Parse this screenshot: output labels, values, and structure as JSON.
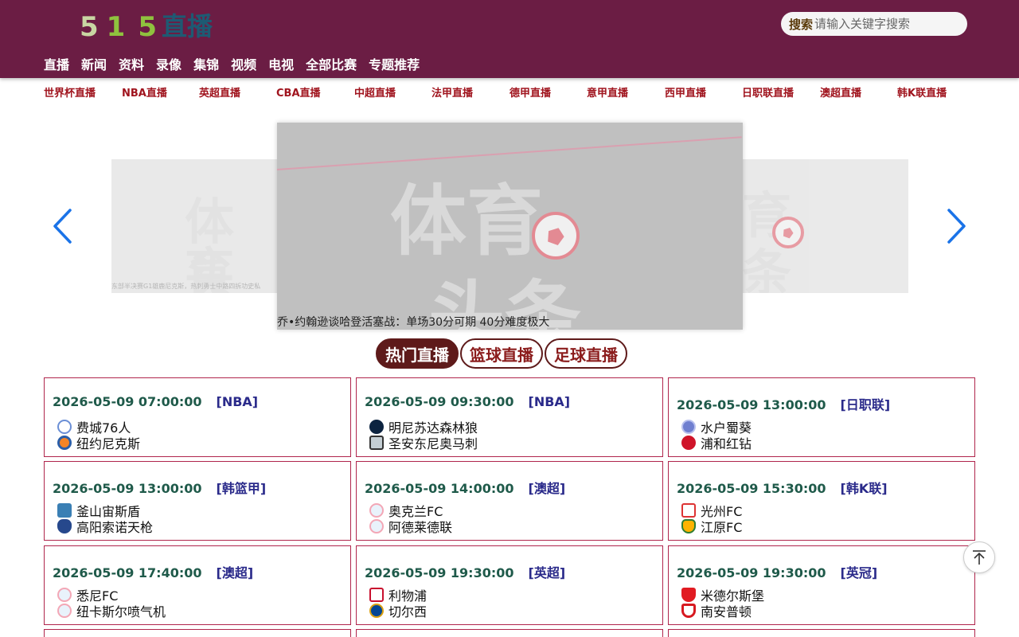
{
  "logo": {
    "digit1": "5",
    "digit2": "1",
    "digit3": "5",
    "text": "直播"
  },
  "search": {
    "label": "搜索",
    "placeholder": "请输入关键字搜索"
  },
  "main_nav": [
    "直播",
    "新闻",
    "资料",
    "录像",
    "集锦",
    "视频",
    "电视",
    "全部比赛",
    "专题推荐"
  ],
  "sub_nav": [
    "世界杯直播",
    "NBA直播",
    "英超直播",
    "CBA直播",
    "中超直播",
    "法甲直播",
    "德甲直播",
    "意甲直播",
    "西甲直播",
    "日职联直播",
    "澳超直播",
    "韩K联直播"
  ],
  "carousel": {
    "center_caption": "乔•约翰逊谈哈登活塞战：单场30分可期 40分难度极大",
    "left_caption": "东部半决赛G1雄鹿尼克斯，热刺勇士中路四拆功史私",
    "watermark_line1": "体育",
    "watermark_line2": "头条"
  },
  "tabs": [
    {
      "label": "热门直播",
      "active": true
    },
    {
      "label": "篮球直播",
      "active": false
    },
    {
      "label": "足球直播",
      "active": false
    }
  ],
  "matches": [
    {
      "time": "2026-05-09 07:00:00",
      "league": "[NBA]",
      "home": "费城76人",
      "away": "纽约尼克斯",
      "home_icon": "nba76",
      "away_icon": "knicks"
    },
    {
      "time": "2026-05-09 09:30:00",
      "league": "[NBA]",
      "home": "明尼苏达森林狼",
      "away": "圣安东尼奥马刺",
      "home_icon": "wolves",
      "away_icon": "spurs"
    },
    {
      "time": "2026-05-09 13:00:00",
      "league": "[日职联]",
      "home": "水户蜀葵",
      "away": "浦和红钻",
      "home_icon": "blue",
      "away_icon": "red"
    },
    {
      "time": "2026-05-09 13:00:00",
      "league": "[韩篮甲]",
      "home": "釜山宙斯盾",
      "away": "高阳索诺天枪",
      "home_icon": "busan",
      "away_icon": "goyang"
    },
    {
      "time": "2026-05-09 14:00:00",
      "league": "[澳超]",
      "home": "奥克兰FC",
      "away": "阿德莱德联",
      "home_icon": "generic",
      "away_icon": "generic"
    },
    {
      "time": "2026-05-09 15:30:00",
      "league": "[韩K联]",
      "home": "光州FC",
      "away": "江原FC",
      "home_icon": "gwangju",
      "away_icon": "gangwon"
    },
    {
      "time": "2026-05-09 17:40:00",
      "league": "[澳超]",
      "home": "悉尼FC",
      "away": "纽卡斯尔喷气机",
      "home_icon": "generic",
      "away_icon": "generic"
    },
    {
      "time": "2026-05-09 19:30:00",
      "league": "[英超]",
      "home": "利物浦",
      "away": "切尔西",
      "home_icon": "liverpool",
      "away_icon": "chelsea"
    },
    {
      "time": "2026-05-09 19:30:00",
      "league": "[英冠]",
      "home": "米德尔斯堡",
      "away": "南安普顿",
      "home_icon": "boro",
      "away_icon": "soton"
    }
  ],
  "colors": {
    "header_bg": "#6b1d44",
    "accent_red": "#a0141e",
    "tab_active": "#5e1a1a",
    "card_border": "#b0254c",
    "arrow_blue": "#1a73e8"
  },
  "icons": {
    "prev": "chevron-left-icon",
    "next": "chevron-right-icon",
    "back_to_top": "arrow-up-to-top-icon"
  }
}
